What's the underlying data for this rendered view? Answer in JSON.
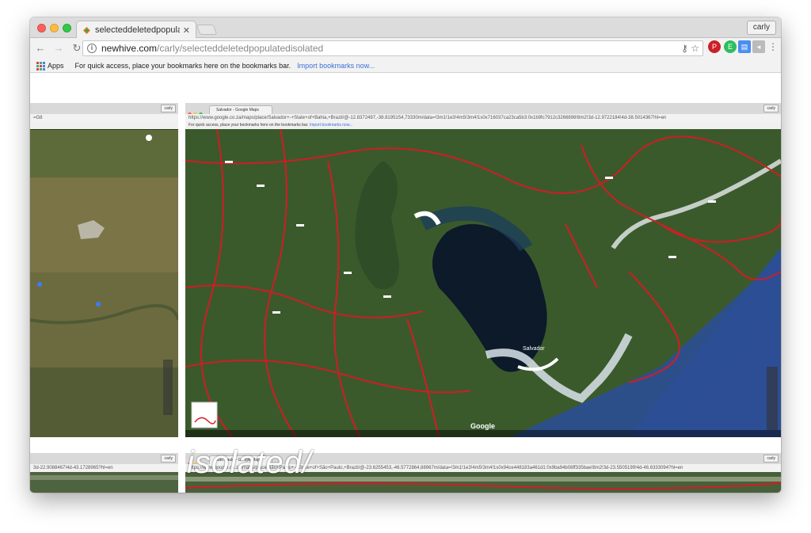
{
  "browser": {
    "tab_title": "selecteddeletedpopulatedisolated",
    "profile": "carly",
    "url_host": "newhive.com",
    "url_path": "/carly/selecteddeletedpopulatedisolated",
    "bookmarks": {
      "apps_label": "Apps",
      "message": "For quick access, place your bookmarks here on the bookmarks bar.",
      "import_link": "Import bookmarks now..."
    }
  },
  "shots": {
    "left_top": {
      "profile": "carly",
      "url": "=G8"
    },
    "main": {
      "tab_title": "Salvador - Google Maps",
      "profile": "carly",
      "url": "https://www.google.co.za/maps/place/Salvador+-+State+of+Bahia,+Brazil/@-12.8372497,-38.8195154,73330m/data=!3m1!1e3!4m5!3m4!1s0x716037ca23ca5b3:0x1b9fc7912c3266898!8m2!3d-12.9722184!4d-38.5014367!hl=en",
      "bookmarks_message": "For quick access, place your bookmarks here on the bookmarks bar.",
      "import_link": "Import bookmarks now...",
      "map_brand": "Google",
      "city_label": "Salvador"
    },
    "left_bottom": {
      "profile": "carly",
      "url": "3d-22.9088467!4d-43.1728965?hl=en"
    },
    "bottom": {
      "tab_title": "São Paulo - Google Maps",
      "profile": "carly",
      "url": "https://www.google.co.za/maps/place/São+Paulo+-+State+of+São+Paulo,+Brazil/@-23.6255453,-46.5772864,88967m/data=!3m1!1e3!4m5!3m4!1s0x94ce448183a461d1:0x9ba94b08ff335bae!8m2!3d-23.5505199!4d-46.6333094?hl=en",
      "overlay_text": "isolated/"
    }
  },
  "colors": {
    "land": "#3a5a2c",
    "water": "#1f3f7a",
    "road": "#d81a23",
    "ocean": "#2a4f9a"
  }
}
